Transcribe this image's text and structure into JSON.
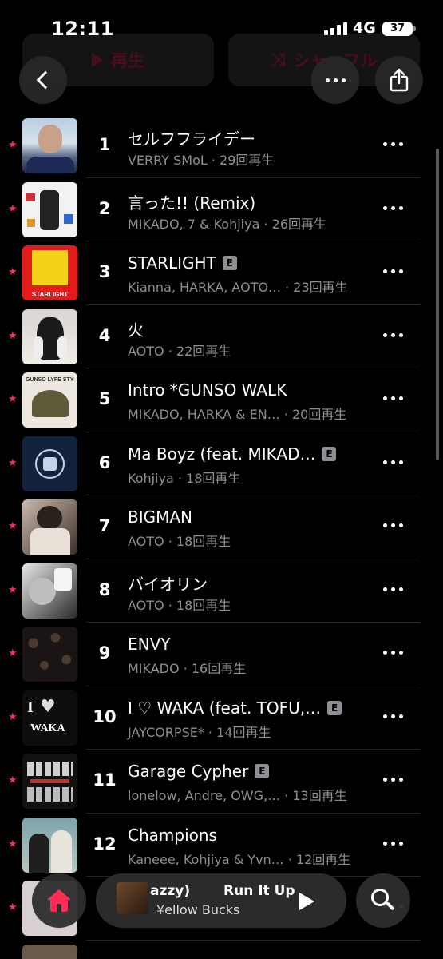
{
  "status_bar": {
    "time": "12:11",
    "network": "4G",
    "battery": "37"
  },
  "header_buttons": {
    "play_label": "再生",
    "shuffle_label": "シャッフル"
  },
  "tracks": [
    {
      "rank": "1",
      "title": "セルフフライデー",
      "subtitle": "VERRY SMoL · 29回再生",
      "explicit": false
    },
    {
      "rank": "2",
      "title": "言った!! (Remix)",
      "subtitle": "MIKADO, 7 & Kohjiya · 26回再生",
      "explicit": false
    },
    {
      "rank": "3",
      "title": "STARLIGHT",
      "subtitle": "Kianna, HARKA, AOTO… · 23回再生",
      "explicit": true
    },
    {
      "rank": "4",
      "title": "火",
      "subtitle": "AOTO · 22回再生",
      "explicit": false
    },
    {
      "rank": "5",
      "title": "Intro *GUNSO WALK",
      "subtitle": "MIKADO, HARKA & EN… · 20回再生",
      "explicit": false
    },
    {
      "rank": "6",
      "title": "Ma Boyz (feat. MIKAD…",
      "subtitle": "Kohjiya · 18回再生",
      "explicit": true
    },
    {
      "rank": "7",
      "title": "BIGMAN",
      "subtitle": "AOTO · 18回再生",
      "explicit": false
    },
    {
      "rank": "8",
      "title": "バイオリン",
      "subtitle": "AOTO · 18回再生",
      "explicit": false
    },
    {
      "rank": "9",
      "title": "ENVY",
      "subtitle": "MIKADO · 16回再生",
      "explicit": false
    },
    {
      "rank": "10",
      "title": "I ♡ WAKA (feat. TOFU,…",
      "subtitle": "JAYCORPSE* · 14回再生",
      "explicit": true
    },
    {
      "rank": "11",
      "title": "Garage Cypher",
      "subtitle": "lonelow, Andre, OWG,… · 13回再生",
      "explicit": true
    },
    {
      "rank": "12",
      "title": "Champions",
      "subtitle": "Kaneee, Kohjiya & Yvn… · 12回再生",
      "explicit": false
    },
    {
      "rank": "",
      "title": "",
      "subtitle": "",
      "explicit": false
    }
  ],
  "album_art_text": {
    "art3": "STARLIGHT",
    "art5": "GUNSO LYFE STYLE",
    "art10": "WAKA"
  },
  "now_playing": {
    "title_a": "azzy)",
    "title_b": "Run It Up",
    "artist": "¥ellow Bucks"
  },
  "colors": {
    "accent": "#ff2d55",
    "secondary_text": "#8e8e93",
    "background": "#000000"
  },
  "icons": {
    "back": "chevron-left-icon",
    "more": "ellipsis-icon",
    "share": "share-icon",
    "favorite": "star-icon",
    "home": "home-icon",
    "search": "search-icon",
    "play": "play-icon"
  }
}
